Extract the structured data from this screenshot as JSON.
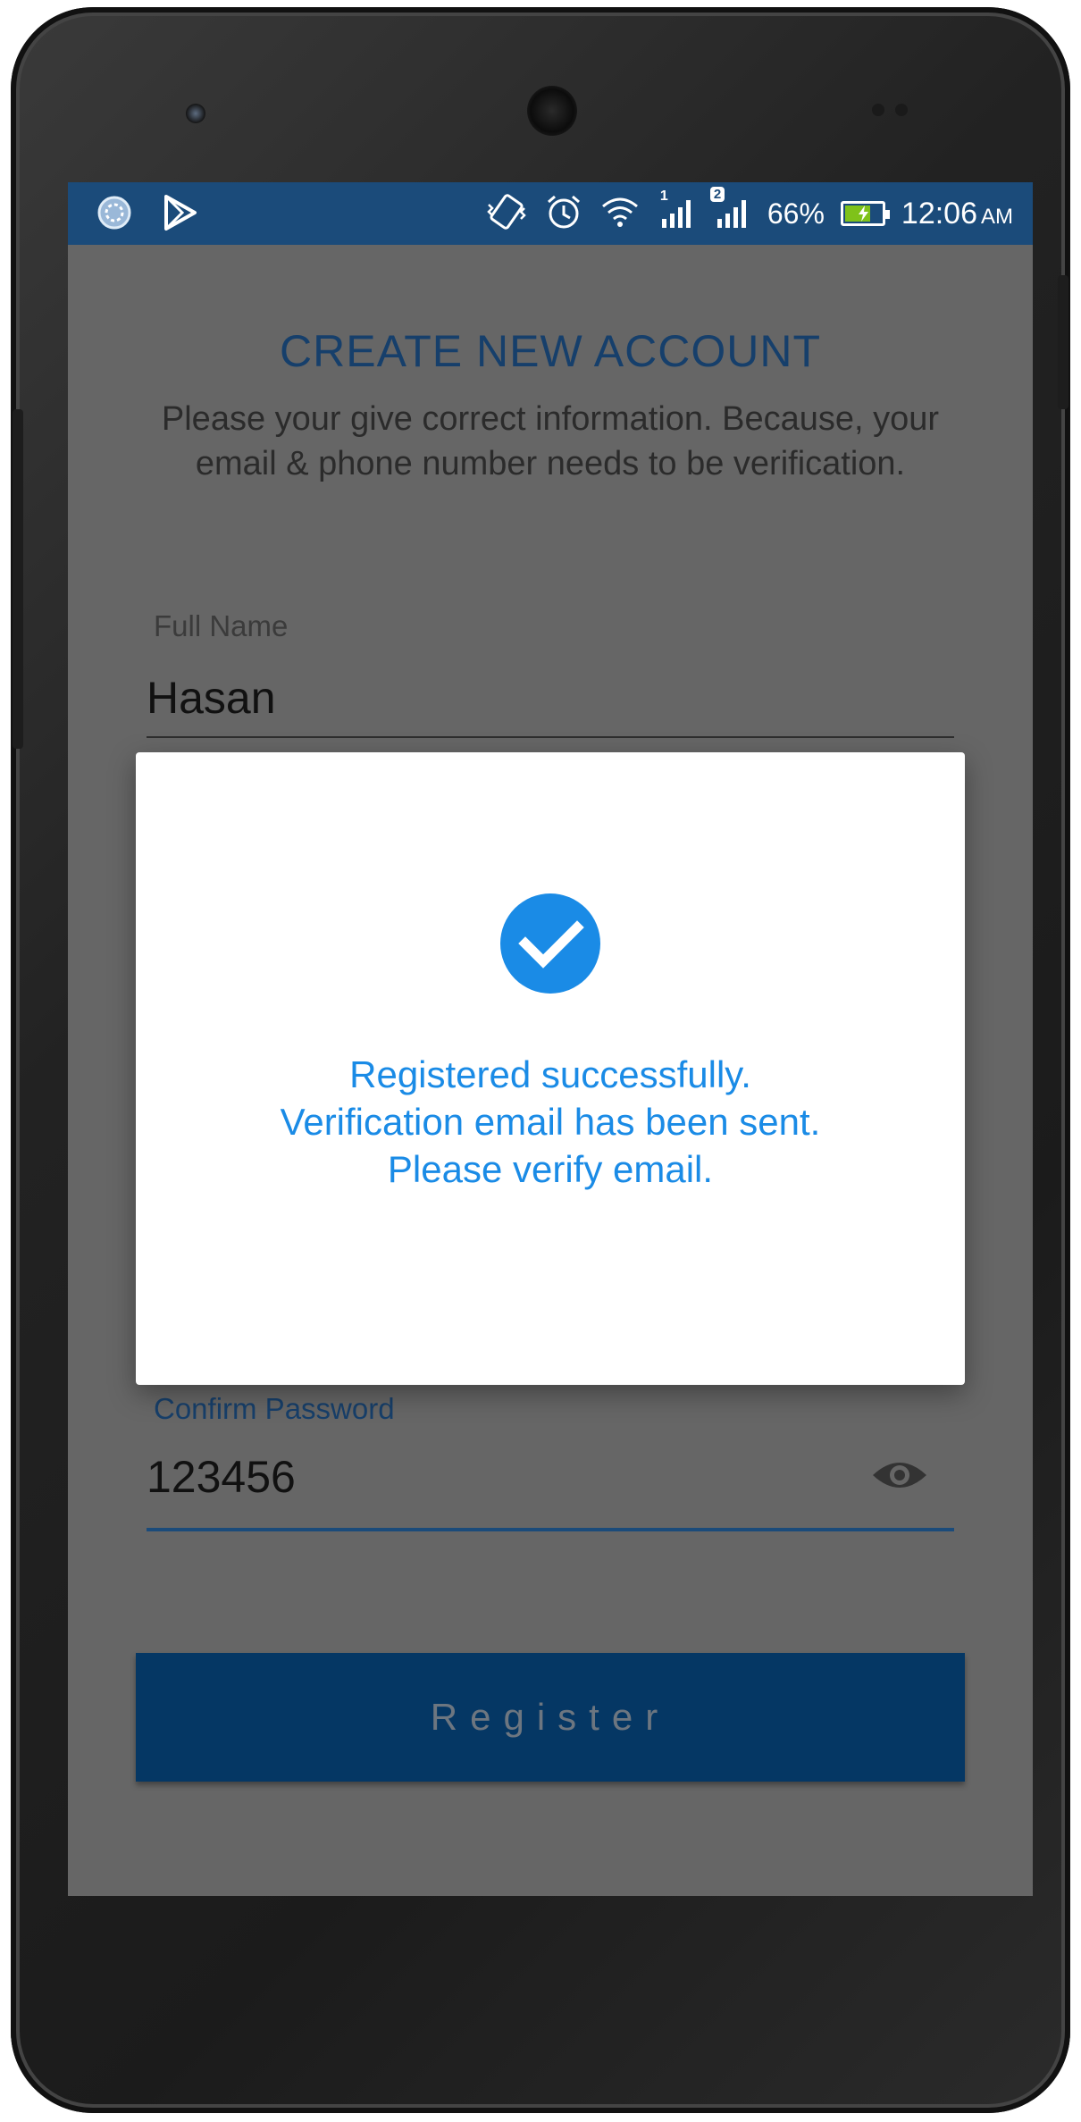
{
  "status_bar": {
    "battery_percent": "66%",
    "time": "12:06",
    "time_suffix": "AM",
    "signal_sim1_label": "1",
    "signal_sim2_label": "2",
    "icons": [
      "loading-circle-icon",
      "play-store-icon",
      "vibrate-icon",
      "alarm-icon",
      "wifi-icon",
      "signal-sim1-icon",
      "signal-sim2-icon",
      "battery-charging-icon"
    ]
  },
  "header": {
    "title": "CREATE NEW ACCOUNT",
    "subtitle": "Please your give correct information. Because, your email & phone number needs to be verification."
  },
  "form": {
    "full_name_label": "Full Name",
    "full_name_value": "Hasan",
    "confirm_password_label": "Confirm Password",
    "confirm_password_value": "123456",
    "register_label": "Register"
  },
  "dialog": {
    "icon": "check-circle-icon",
    "line1": "Registered successfully.",
    "line2": "Verification email has been sent.",
    "line3": "Please verify email."
  },
  "colors": {
    "status_bar": "#1b4b7a",
    "title": "#163f6b",
    "dialog_text": "#1a8be6",
    "check_circle": "#1a8be6",
    "register_button": "#053764",
    "overlay_background": "#666666"
  }
}
